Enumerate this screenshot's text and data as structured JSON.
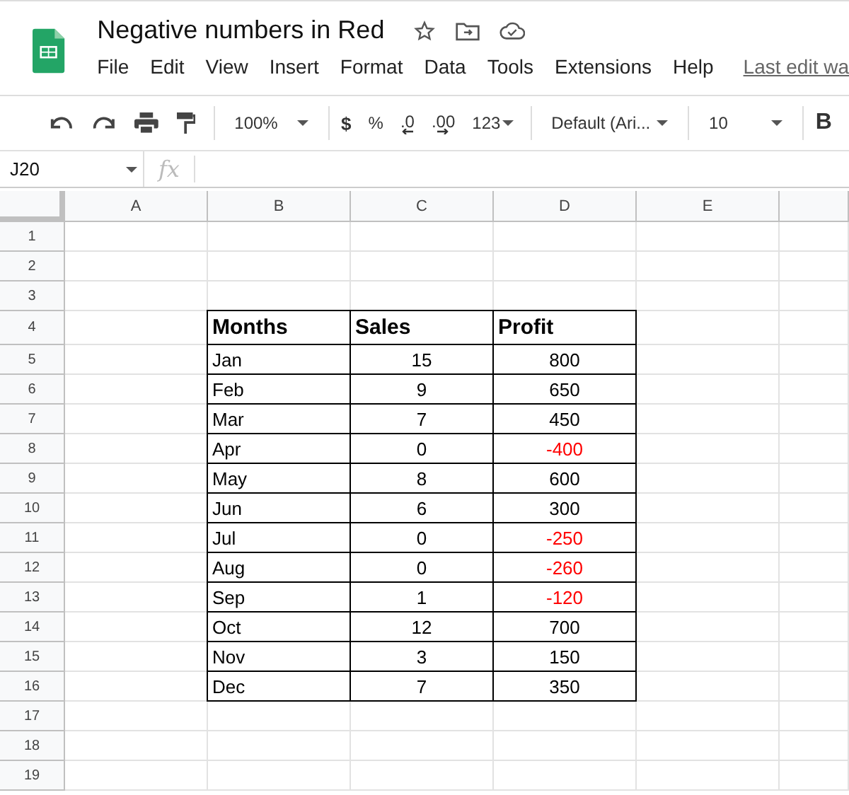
{
  "document": {
    "title": "Negative numbers in Red",
    "menu": [
      "File",
      "Edit",
      "View",
      "Insert",
      "Format",
      "Data",
      "Tools",
      "Extensions",
      "Help"
    ],
    "last_edit": "Last edit wa"
  },
  "toolbar": {
    "zoom": "100%",
    "currency": "$",
    "percent": "%",
    "decimal_less": ".0",
    "decimal_more": ".00",
    "number_format": "123",
    "font": "Default (Ari...",
    "font_size": "10",
    "bold": "B"
  },
  "formula_bar": {
    "cell_ref": "J20",
    "fx": "fx"
  },
  "sheet": {
    "columns": [
      "A",
      "B",
      "C",
      "D",
      "E"
    ],
    "rows": [
      {
        "label": "1"
      },
      {
        "label": "2"
      },
      {
        "label": "3"
      },
      {
        "label": "4",
        "kind": "header",
        "cells": [
          {
            "text": "Months"
          },
          {
            "text": "Sales"
          },
          {
            "text": "Profit"
          }
        ]
      },
      {
        "label": "5",
        "kind": "data",
        "cells": [
          {
            "text": "Jan"
          },
          {
            "text": "15"
          },
          {
            "text": "800",
            "color": "#000000"
          }
        ]
      },
      {
        "label": "6",
        "kind": "data",
        "cells": [
          {
            "text": "Feb"
          },
          {
            "text": "9"
          },
          {
            "text": "650",
            "color": "#000000"
          }
        ]
      },
      {
        "label": "7",
        "kind": "data",
        "cells": [
          {
            "text": "Mar"
          },
          {
            "text": "7"
          },
          {
            "text": "450",
            "color": "#000000"
          }
        ]
      },
      {
        "label": "8",
        "kind": "data",
        "cells": [
          {
            "text": "Apr"
          },
          {
            "text": "0"
          },
          {
            "text": "-400",
            "color": "#ff0000"
          }
        ]
      },
      {
        "label": "9",
        "kind": "data",
        "cells": [
          {
            "text": "May"
          },
          {
            "text": "8"
          },
          {
            "text": "600",
            "color": "#000000"
          }
        ]
      },
      {
        "label": "10",
        "kind": "data",
        "cells": [
          {
            "text": "Jun"
          },
          {
            "text": "6"
          },
          {
            "text": "300",
            "color": "#000000"
          }
        ]
      },
      {
        "label": "11",
        "kind": "data",
        "cells": [
          {
            "text": "Jul"
          },
          {
            "text": "0"
          },
          {
            "text": "-250",
            "color": "#ff0000"
          }
        ]
      },
      {
        "label": "12",
        "kind": "data",
        "cells": [
          {
            "text": "Aug"
          },
          {
            "text": "0"
          },
          {
            "text": "-260",
            "color": "#ff0000"
          }
        ]
      },
      {
        "label": "13",
        "kind": "data",
        "cells": [
          {
            "text": "Sep"
          },
          {
            "text": "1"
          },
          {
            "text": "-120",
            "color": "#ff0000"
          }
        ]
      },
      {
        "label": "14",
        "kind": "data",
        "cells": [
          {
            "text": "Oct"
          },
          {
            "text": "12"
          },
          {
            "text": "700",
            "color": "#000000"
          }
        ]
      },
      {
        "label": "15",
        "kind": "data",
        "cells": [
          {
            "text": "Nov"
          },
          {
            "text": "3"
          },
          {
            "text": "150",
            "color": "#000000"
          }
        ]
      },
      {
        "label": "16",
        "kind": "data",
        "cells": [
          {
            "text": "Dec"
          },
          {
            "text": "7"
          },
          {
            "text": "350",
            "color": "#000000"
          }
        ]
      },
      {
        "label": "17"
      },
      {
        "label": "18"
      },
      {
        "label": "19"
      }
    ]
  }
}
